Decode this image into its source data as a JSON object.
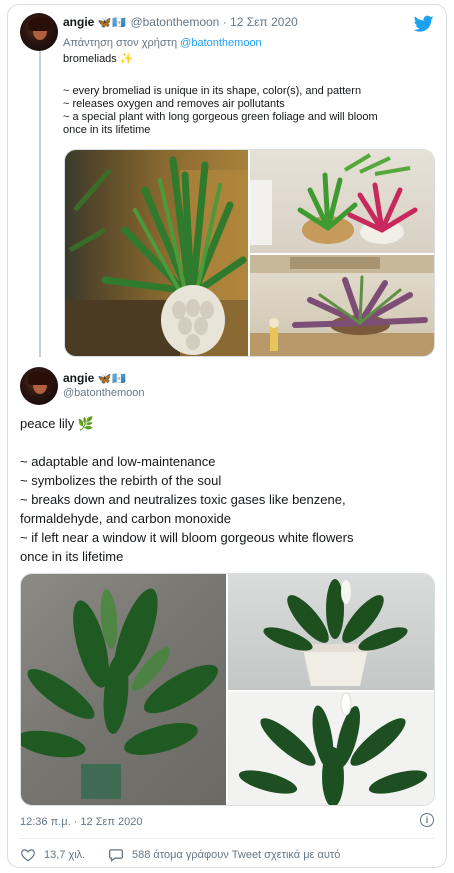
{
  "tweet1": {
    "display_name": "angie",
    "flags": "🦋🇬🇹",
    "handle": "@batonthemoon",
    "separator": "·",
    "date": "12 Σεπ 2020",
    "reply_prefix": "Απάντηση στον χρήστη",
    "reply_handle": "@batonthemoon",
    "title": "bromeliads ✨",
    "lines": [
      "~ every bromeliad is unique in its shape, color(s), and pattern",
      "~ releases oxygen and removes air pollutants",
      "~ a special plant with long gorgeous green foliage and will bloom",
      "once in its lifetime"
    ]
  },
  "tweet2": {
    "display_name": "angie",
    "flags": "🦋🇬🇹",
    "handle": "@batonthemoon",
    "title": "peace lily 🌿",
    "lines": [
      "~ adaptable and low-maintenance",
      "~ symbolizes the rebirth of the soul",
      "~ breaks down and neutralizes toxic gases like benzene,",
      "formaldehyde, and carbon monoxide",
      "~ if left near a window it will bloom gorgeous white flowers",
      "once in its lifetime"
    ],
    "timestamp": "12:36 π.μ. · 12 Σεπ 2020",
    "likes": "13,7 χιλ.",
    "talking": "588 άτομα γράφουν Tweet σχετικά με αυτό"
  },
  "colors": {
    "accent": "#1da1f2",
    "muted": "#657786",
    "like": "#657786"
  },
  "icons": [
    "twitter-logo-icon",
    "info-icon",
    "heart-icon",
    "comment-bubble-icon"
  ]
}
